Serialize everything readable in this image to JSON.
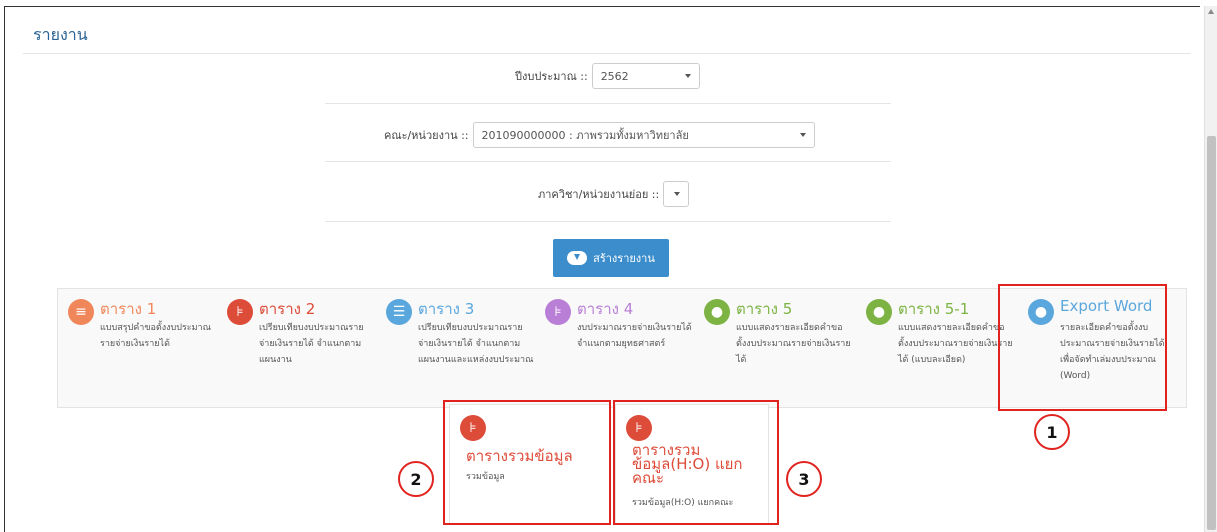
{
  "page": {
    "title": "รายงาน"
  },
  "form": {
    "budget_year": {
      "label": "ปีงบประมาณ ::",
      "value": "2562"
    },
    "faculty": {
      "label": "คณะ/หน่วยงาน ::",
      "value": "201090000000 : ภาพรวมทั้งมหาวิทยาลัย"
    },
    "department": {
      "label": "ภาควิชา/หน่วยงานย่อย ::",
      "value": ""
    },
    "create_button": {
      "label": "สร้างรายงาน",
      "icon": "cloud-download-icon"
    }
  },
  "report_cards": [
    {
      "title": "ตาราง 1",
      "desc": "แบบสรุปคำขอตั้งงบประมาณรายจ่ายเงินรายได้",
      "icon": "list-icon",
      "color": "#f0875a"
    },
    {
      "title": "ตาราง 2",
      "desc": "เปรียบเทียบงบประมาณรายจ่ายเงินรายได้ จำแนกตามแผนงาน",
      "icon": "sitemap-icon",
      "color": "#dd4b39"
    },
    {
      "title": "ตาราง 3",
      "desc": "เปรียบเทียบงบประมาณรายจ่ายเงินรายได้ จำแนกตามแผนงานและแหล่งงบประมาณ",
      "icon": "table-icon",
      "color": "#5aa7dd"
    },
    {
      "title": "ตาราง 4",
      "desc": "งบประมาณรายจ่ายเงินรายได้ จำแนกตามยุทธศาสตร์",
      "icon": "tree-icon",
      "color": "#b97fd6"
    },
    {
      "title": "ตาราง 5",
      "desc": "แบบแสดงรายละเอียดคำขอตั้งงบประมาณรายจ่ายเงินรายได้",
      "icon": "comments-icon",
      "color": "#7cb342"
    },
    {
      "title": "ตาราง 5-1",
      "desc": "แบบแสดงรายละเอียดคำขอตั้งงบประมาณรายจ่ายเงินรายได้ (แบบละเอียด)",
      "icon": "comments-icon",
      "color": "#7cb342"
    },
    {
      "title": "Export Word",
      "desc": "รายละเอียดคำขอตั้งงบประมาณรายจ่ายเงินรายได้ เพื่อจัดทำเล่มงบประมาณ (Word)",
      "icon": "comments-icon",
      "color": "#5aa7dd"
    }
  ],
  "sub_cards": [
    {
      "title": "ตารางรวมข้อมูล",
      "desc": "รวมข้อมูล",
      "icon": "sitemap-icon"
    },
    {
      "title": "ตารางรวมข้อมูล(H:O) แยกคณะ",
      "desc": "รวมข้อมูล(H:O) แยกคณะ",
      "icon": "sitemap-icon"
    }
  ],
  "callouts": [
    "1",
    "2",
    "3"
  ],
  "colors": {
    "annotation": "#e0231f",
    "primary": "#3c8dcb",
    "sub_title": "#dd4b39"
  }
}
